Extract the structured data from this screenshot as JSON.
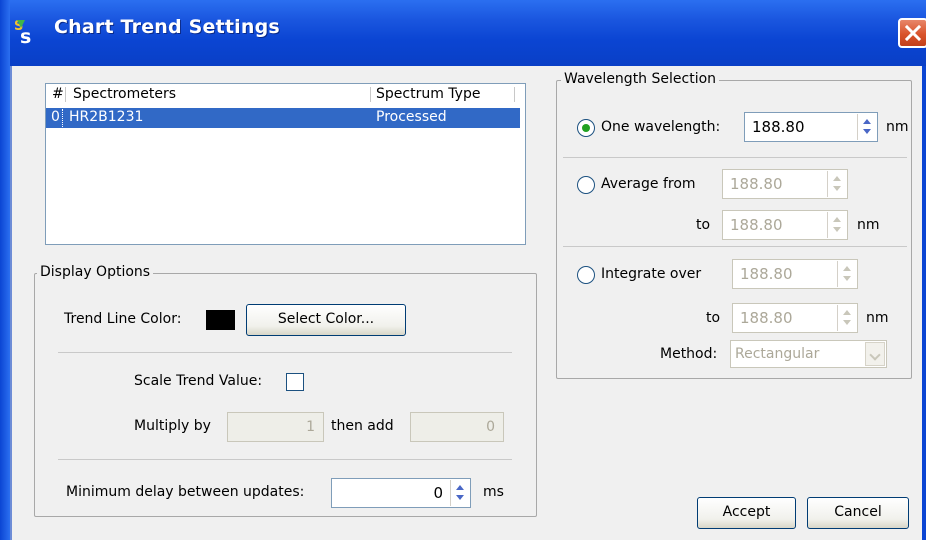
{
  "window": {
    "title": "Chart Trend Settings",
    "logo_icon": "app-logo-icon",
    "close_icon": "close-icon"
  },
  "spectrometer_table": {
    "headers": {
      "index": "#",
      "spectrometers": "Spectrometers",
      "spectrum_type": "Spectrum Type"
    },
    "rows": [
      {
        "index": "0",
        "spectrometer": "HR2B1231",
        "spectrum_type": "Processed"
      }
    ]
  },
  "display_options": {
    "legend": "Display Options",
    "trend_line_color_label": "Trend Line Color:",
    "trend_line_color": "#000000",
    "select_color_button": "Select Color...",
    "scale_trend_label": "Scale Trend Value:",
    "scale_trend_checked": false,
    "multiply_by_label": "Multiply by",
    "multiply_by_value": "1",
    "then_add_label": "then add",
    "then_add_value": "0",
    "min_delay_label": "Minimum delay between updates:",
    "min_delay_value": "0",
    "min_delay_unit": "ms"
  },
  "wavelength_selection": {
    "legend": "Wavelength Selection",
    "selected": "one_wavelength",
    "one_wavelength": {
      "label": "One wavelength:",
      "value": "188.80",
      "unit": "nm"
    },
    "average": {
      "label": "Average from",
      "from": "188.80",
      "to_label": "to",
      "to": "188.80",
      "unit": "nm"
    },
    "integrate": {
      "label": "Integrate over",
      "from": "188.80",
      "to_label": "to",
      "to": "188.80",
      "unit": "nm",
      "method_label": "Method:",
      "method_value": "Rectangular"
    }
  },
  "buttons": {
    "accept": "Accept",
    "cancel": "Cancel"
  },
  "colors": {
    "title_bar": "#0b45d3",
    "selection": "#3169c6",
    "radio_on": "#21a121",
    "close": "#d9532b"
  }
}
